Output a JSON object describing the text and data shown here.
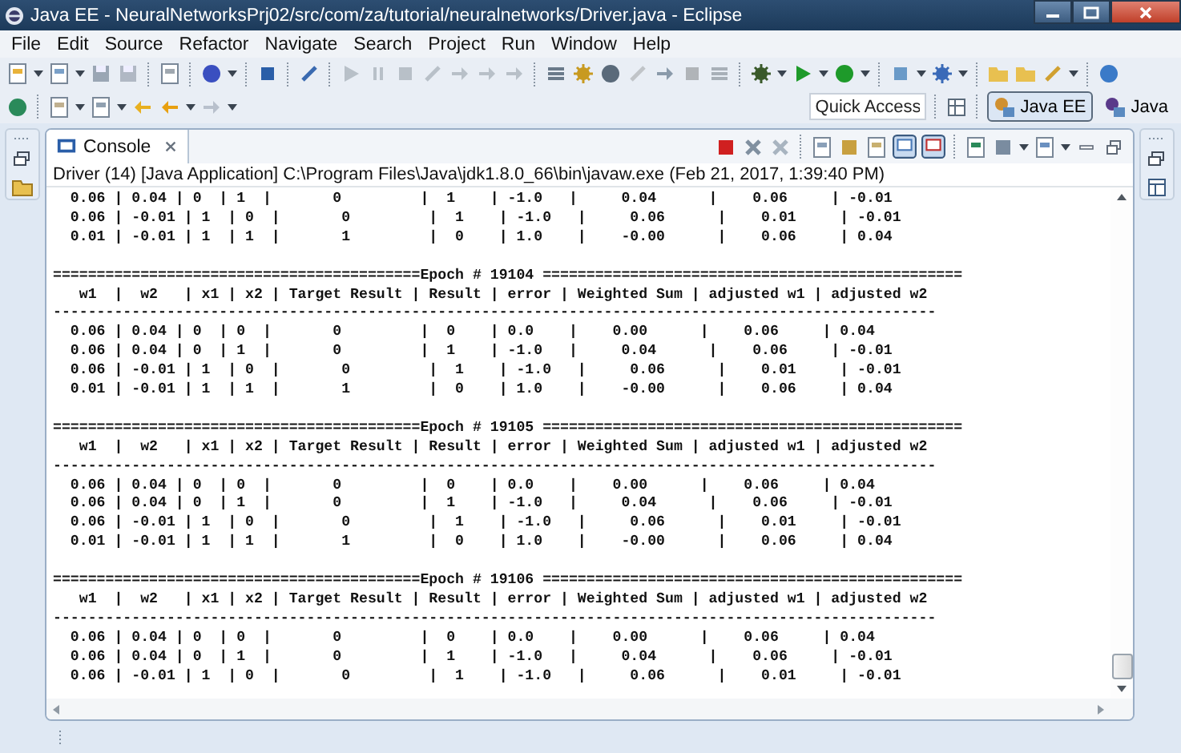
{
  "window": {
    "title": "Java EE - NeuralNetworksPrj02/src/com/za/tutorial/neuralnetworks/Driver.java - Eclipse"
  },
  "menu": [
    "File",
    "Edit",
    "Source",
    "Refactor",
    "Navigate",
    "Search",
    "Project",
    "Run",
    "Window",
    "Help"
  ],
  "quick_access": {
    "placeholder": "Quick Access"
  },
  "perspectives": [
    {
      "label": "Java EE",
      "selected": true
    },
    {
      "label": "Java",
      "selected": false
    }
  ],
  "console": {
    "tab": "Console",
    "description": "Driver (14) [Java Application] C:\\Program Files\\Java\\jdk1.8.0_66\\bin\\javaw.exe (Feb 21, 2017, 1:39:40 PM)",
    "sections": [
      {
        "lines": [
          "  0.06 | 0.04 | 0  | 1  |       0         |  1    | -1.0   |     0.04      |    0.06     | -0.01",
          "  0.06 | -0.01 | 1  | 0  |       0         |  1    | -1.0   |     0.06      |    0.01     | -0.01",
          "  0.01 | -0.01 | 1  | 1  |       1         |  0    | 1.0    |    -0.00      |    0.06     | 0.04"
        ]
      },
      {
        "lines": [
          "==========================================Epoch # 19104 ================================================",
          "   w1  |  w2   | x1 | x2 | Target Result | Result | error | Weighted Sum | adjusted w1 | adjusted w2",
          "-----------------------------------------------------------------------------------------------------",
          "  0.06 | 0.04 | 0  | 0  |       0         |  0    | 0.0    |    0.00      |    0.06     | 0.04",
          "  0.06 | 0.04 | 0  | 1  |       0         |  1    | -1.0   |     0.04      |    0.06     | -0.01",
          "  0.06 | -0.01 | 1  | 0  |       0         |  1    | -1.0   |     0.06      |    0.01     | -0.01",
          "  0.01 | -0.01 | 1  | 1  |       1         |  0    | 1.0    |    -0.00      |    0.06     | 0.04"
        ]
      },
      {
        "lines": [
          "==========================================Epoch # 19105 ================================================",
          "   w1  |  w2   | x1 | x2 | Target Result | Result | error | Weighted Sum | adjusted w1 | adjusted w2",
          "-----------------------------------------------------------------------------------------------------",
          "  0.06 | 0.04 | 0  | 0  |       0         |  0    | 0.0    |    0.00      |    0.06     | 0.04",
          "  0.06 | 0.04 | 0  | 1  |       0         |  1    | -1.0   |     0.04      |    0.06     | -0.01",
          "  0.06 | -0.01 | 1  | 0  |       0         |  1    | -1.0   |     0.06      |    0.01     | -0.01",
          "  0.01 | -0.01 | 1  | 1  |       1         |  0    | 1.0    |    -0.00      |    0.06     | 0.04"
        ]
      },
      {
        "lines": [
          "==========================================Epoch # 19106 ================================================",
          "   w1  |  w2   | x1 | x2 | Target Result | Result | error | Weighted Sum | adjusted w1 | adjusted w2",
          "-----------------------------------------------------------------------------------------------------",
          "  0.06 | 0.04 | 0  | 0  |       0         |  0    | 0.0    |    0.00      |    0.06     | 0.04",
          "  0.06 | 0.04 | 0  | 1  |       0         |  1    | -1.0   |     0.04      |    0.06     | -0.01",
          "  0.06 | -0.01 | 1  | 0  |       0         |  1    | -1.0   |     0.06      |    0.01     | -0.01"
        ]
      }
    ]
  }
}
